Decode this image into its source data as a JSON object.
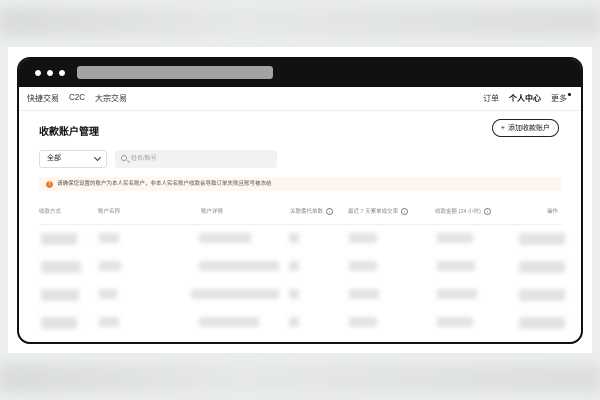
{
  "nav": {
    "left": [
      "快捷交易",
      "C2C",
      "大宗交易"
    ],
    "right": [
      "订单",
      "个人中心",
      "更多"
    ],
    "active": "个人中心"
  },
  "page": {
    "title": "收款账户管理",
    "add_button": "添加收款账户",
    "filter_value": "全部",
    "search_placeholder": "姓名/账号",
    "notice": "请确保您设置的账户为本人实名账户，非本人实名账户收款会导致订单失败且账号被冻结"
  },
  "table": {
    "columns": [
      "收款方式",
      "账户名称",
      "账户详情",
      "关联委托单数",
      "最近 7 天累单成交率",
      "收款金额 (24 小时)",
      "操作"
    ]
  },
  "colors": {
    "warn": "#f07a21",
    "notice_bg": "#fff6ee",
    "frame": "#111111"
  }
}
